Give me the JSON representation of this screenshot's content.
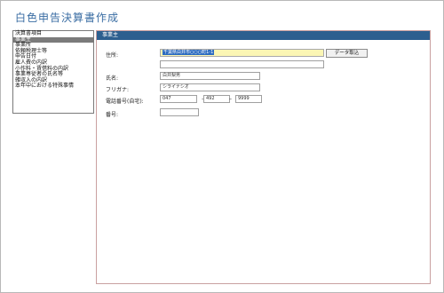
{
  "window": {
    "title": "白色申告決算書作成"
  },
  "sidebar": {
    "items": [
      {
        "label": "決算書項目",
        "selected": false
      },
      {
        "label": "事業主",
        "selected": true
      },
      {
        "label": "事業所",
        "selected": false
      },
      {
        "label": "依頼税理士等",
        "selected": false
      },
      {
        "label": "申告日付",
        "selected": false
      },
      {
        "label": "雇人費の内訳",
        "selected": false
      },
      {
        "label": "小作料・賃借料の内訳",
        "selected": false
      },
      {
        "label": "事業専従者の氏名等",
        "selected": false
      },
      {
        "label": "雑収入の内訳",
        "selected": false
      },
      {
        "label": "本年中における特殊事情",
        "selected": false
      }
    ]
  },
  "panel": {
    "header": "事業主",
    "address": {
      "label": "住所:",
      "line1": "千葉県白井市○○○町1-1",
      "line2": ""
    },
    "data_button": "データ取込",
    "name": {
      "label": "氏名:",
      "value": "白井梨男"
    },
    "furigana": {
      "label": "フリガナ:",
      "value": "シライナシオ"
    },
    "phone": {
      "label": "電話番号(自宅):",
      "part1": "047",
      "part2": "492",
      "part3": "9999",
      "separator": "–"
    },
    "number": {
      "label": "番号:",
      "value": ""
    }
  },
  "colors": {
    "accent": "#2c5f8f",
    "title": "#3a6da3",
    "highlight_field": "#fbf6b4",
    "selection": "#2d6cc0"
  }
}
